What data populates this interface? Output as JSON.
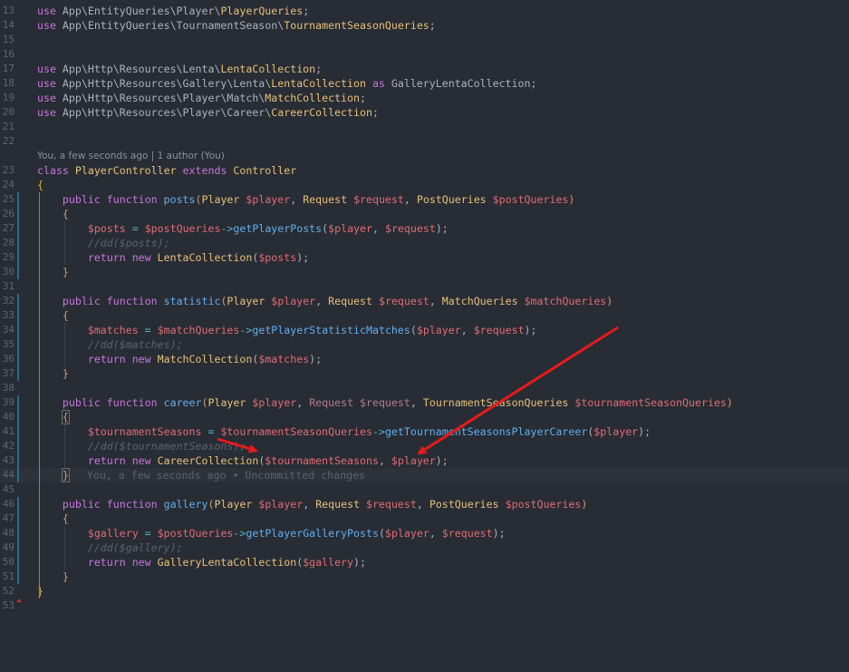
{
  "editor": {
    "blame_header": "You, a few seconds ago | 1 author (You)",
    "inline_blame": "You, a few seconds ago • Uncommitted changes",
    "lines": [
      {
        "n": "13",
        "tokens": [
          [
            "kw",
            "use "
          ],
          [
            "ns",
            "App\\EntityQueries\\Player\\"
          ],
          [
            "cls",
            "PlayerQueries"
          ],
          [
            "pun",
            ";"
          ]
        ]
      },
      {
        "n": "14",
        "tokens": [
          [
            "kw",
            "use "
          ],
          [
            "ns",
            "App\\EntityQueries\\TournamentSeason\\"
          ],
          [
            "cls",
            "TournamentSeasonQueries"
          ],
          [
            "pun",
            ";"
          ]
        ]
      },
      {
        "n": "15",
        "tokens": []
      },
      {
        "n": "16",
        "tokens": []
      },
      {
        "n": "17",
        "tokens": [
          [
            "kw",
            "use "
          ],
          [
            "ns",
            "App\\Http\\Resources\\Lenta\\"
          ],
          [
            "cls",
            "LentaCollection"
          ],
          [
            "pun",
            ";"
          ]
        ]
      },
      {
        "n": "18",
        "tokens": [
          [
            "kw",
            "use "
          ],
          [
            "ns",
            "App\\Http\\Resources\\Gallery\\Lenta\\"
          ],
          [
            "cls",
            "LentaCollection"
          ],
          [
            "kw",
            " as "
          ],
          [
            "ns",
            "GalleryLentaCollection"
          ],
          [
            "pun",
            ";"
          ]
        ]
      },
      {
        "n": "19",
        "tokens": [
          [
            "kw",
            "use "
          ],
          [
            "ns",
            "App\\Http\\Resources\\Player\\Match\\"
          ],
          [
            "cls",
            "MatchCollection"
          ],
          [
            "pun",
            ";"
          ]
        ]
      },
      {
        "n": "20",
        "tokens": [
          [
            "kw",
            "use "
          ],
          [
            "ns",
            "App\\Http\\Resources\\Player\\Career\\"
          ],
          [
            "cls",
            "CareerCollection"
          ],
          [
            "pun",
            ";"
          ]
        ]
      },
      {
        "n": "21",
        "tokens": []
      },
      {
        "n": "22",
        "tokens": []
      },
      {
        "n": "23",
        "tokens": [
          [
            "kw",
            "class "
          ],
          [
            "cls",
            "PlayerController "
          ],
          [
            "kw",
            "extends "
          ],
          [
            "cls",
            "Controller"
          ]
        ]
      },
      {
        "n": "24",
        "tokens": [
          [
            "brace",
            "{"
          ]
        ]
      },
      {
        "n": "25",
        "tokens": [
          [
            "pun",
            "    "
          ],
          [
            "kw",
            "public function "
          ],
          [
            "fn",
            "posts"
          ],
          [
            "br",
            "("
          ],
          [
            "cls",
            "Player "
          ],
          [
            "var",
            "$player"
          ],
          [
            "pun",
            ", "
          ],
          [
            "cls",
            "Request "
          ],
          [
            "var",
            "$request"
          ],
          [
            "pun",
            ", "
          ],
          [
            "cls",
            "PostQueries "
          ],
          [
            "var",
            "$postQueries"
          ],
          [
            "br",
            ")"
          ]
        ]
      },
      {
        "n": "26",
        "tokens": [
          [
            "pun",
            "    "
          ],
          [
            "br",
            "{"
          ]
        ]
      },
      {
        "n": "27",
        "tokens": [
          [
            "pun",
            "        "
          ],
          [
            "var",
            "$posts"
          ],
          [
            "op",
            " = "
          ],
          [
            "var",
            "$postQueries"
          ],
          [
            "op",
            "->"
          ],
          [
            "fn",
            "getPlayerPosts"
          ],
          [
            "pun",
            "("
          ],
          [
            "var",
            "$player"
          ],
          [
            "pun",
            ", "
          ],
          [
            "var",
            "$request"
          ],
          [
            "pun",
            ");"
          ]
        ]
      },
      {
        "n": "28",
        "tokens": [
          [
            "pun",
            "        "
          ],
          [
            "cmt",
            "//dd($posts);"
          ]
        ]
      },
      {
        "n": "29",
        "tokens": [
          [
            "pun",
            "        "
          ],
          [
            "kw",
            "return new "
          ],
          [
            "cls",
            "LentaCollection"
          ],
          [
            "pun",
            "("
          ],
          [
            "var",
            "$posts"
          ],
          [
            "pun",
            ");"
          ]
        ]
      },
      {
        "n": "30",
        "tokens": [
          [
            "pun",
            "    "
          ],
          [
            "br",
            "}"
          ]
        ]
      },
      {
        "n": "31",
        "tokens": []
      },
      {
        "n": "32",
        "tokens": [
          [
            "pun",
            "    "
          ],
          [
            "kw",
            "public function "
          ],
          [
            "fn",
            "statistic"
          ],
          [
            "br",
            "("
          ],
          [
            "cls",
            "Player "
          ],
          [
            "var",
            "$player"
          ],
          [
            "pun",
            ", "
          ],
          [
            "cls",
            "Request "
          ],
          [
            "var",
            "$request"
          ],
          [
            "pun",
            ", "
          ],
          [
            "cls",
            "MatchQueries "
          ],
          [
            "var",
            "$matchQueries"
          ],
          [
            "br",
            ")"
          ]
        ]
      },
      {
        "n": "33",
        "tokens": [
          [
            "pun",
            "    "
          ],
          [
            "br",
            "{"
          ]
        ]
      },
      {
        "n": "34",
        "tokens": [
          [
            "pun",
            "        "
          ],
          [
            "var",
            "$matches"
          ],
          [
            "op",
            " = "
          ],
          [
            "var",
            "$matchQueries"
          ],
          [
            "op",
            "->"
          ],
          [
            "fn",
            "getPlayerStatisticMatches"
          ],
          [
            "pun",
            "("
          ],
          [
            "var",
            "$player"
          ],
          [
            "pun",
            ", "
          ],
          [
            "var",
            "$request"
          ],
          [
            "pun",
            ");"
          ]
        ]
      },
      {
        "n": "35",
        "tokens": [
          [
            "pun",
            "        "
          ],
          [
            "cmt",
            "//dd($matches);"
          ]
        ]
      },
      {
        "n": "36",
        "tokens": [
          [
            "pun",
            "        "
          ],
          [
            "kw",
            "return new "
          ],
          [
            "cls",
            "MatchCollection"
          ],
          [
            "pun",
            "("
          ],
          [
            "var",
            "$matches"
          ],
          [
            "pun",
            ");"
          ]
        ]
      },
      {
        "n": "37",
        "tokens": [
          [
            "pun",
            "    "
          ],
          [
            "br",
            "}"
          ]
        ]
      },
      {
        "n": "38",
        "tokens": []
      },
      {
        "n": "39",
        "tokens": [
          [
            "pun",
            "    "
          ],
          [
            "kw",
            "public function "
          ],
          [
            "fn",
            "career"
          ],
          [
            "br",
            "("
          ],
          [
            "cls",
            "Player "
          ],
          [
            "var",
            "$player"
          ],
          [
            "pun",
            ", "
          ],
          [
            "dim",
            "Request $request"
          ],
          [
            "pun",
            ", "
          ],
          [
            "cls",
            "TournamentSeasonQueries "
          ],
          [
            "var",
            "$tournamentSeasonQueries"
          ],
          [
            "br",
            ")"
          ]
        ]
      },
      {
        "n": "40",
        "tokens": [
          [
            "pun",
            "    "
          ],
          [
            "br",
            "{"
          ]
        ]
      },
      {
        "n": "41",
        "tokens": [
          [
            "pun",
            "        "
          ],
          [
            "var",
            "$tournamentSeasons"
          ],
          [
            "op",
            " = "
          ],
          [
            "var",
            "$tournamentSeasonQueries"
          ],
          [
            "op",
            "->"
          ],
          [
            "fn",
            "getTournamentSeasonsPlayerCareer"
          ],
          [
            "pun",
            "("
          ],
          [
            "var",
            "$player"
          ],
          [
            "pun",
            ");"
          ]
        ]
      },
      {
        "n": "42",
        "tokens": [
          [
            "pun",
            "        "
          ],
          [
            "cmt",
            "//dd($tournamentSeasons);"
          ]
        ]
      },
      {
        "n": "43",
        "tokens": [
          [
            "pun",
            "        "
          ],
          [
            "kw",
            "return new "
          ],
          [
            "cls",
            "CareerCollection"
          ],
          [
            "pun",
            "("
          ],
          [
            "var",
            "$tournamentSeasons"
          ],
          [
            "pun",
            ", "
          ],
          [
            "var",
            "$player"
          ],
          [
            "pun",
            ");"
          ]
        ]
      },
      {
        "n": "44",
        "tokens": [
          [
            "pun",
            "    "
          ],
          [
            "br",
            "}"
          ]
        ]
      },
      {
        "n": "45",
        "tokens": []
      },
      {
        "n": "46",
        "tokens": [
          [
            "pun",
            "    "
          ],
          [
            "kw",
            "public function "
          ],
          [
            "fn",
            "gallery"
          ],
          [
            "br",
            "("
          ],
          [
            "cls",
            "Player "
          ],
          [
            "var",
            "$player"
          ],
          [
            "pun",
            ", "
          ],
          [
            "cls",
            "Request "
          ],
          [
            "var",
            "$request"
          ],
          [
            "pun",
            ", "
          ],
          [
            "cls",
            "PostQueries "
          ],
          [
            "var",
            "$postQueries"
          ],
          [
            "br",
            ")"
          ]
        ]
      },
      {
        "n": "47",
        "tokens": [
          [
            "pun",
            "    "
          ],
          [
            "br",
            "{"
          ]
        ]
      },
      {
        "n": "48",
        "tokens": [
          [
            "pun",
            "        "
          ],
          [
            "var",
            "$gallery"
          ],
          [
            "op",
            " = "
          ],
          [
            "var",
            "$postQueries"
          ],
          [
            "op",
            "->"
          ],
          [
            "fn",
            "getPlayerGalleryPosts"
          ],
          [
            "pun",
            "("
          ],
          [
            "var",
            "$player"
          ],
          [
            "pun",
            ", "
          ],
          [
            "var",
            "$request"
          ],
          [
            "pun",
            ");"
          ]
        ]
      },
      {
        "n": "49",
        "tokens": [
          [
            "pun",
            "        "
          ],
          [
            "cmt",
            "//dd($gallery);"
          ]
        ]
      },
      {
        "n": "50",
        "tokens": [
          [
            "pun",
            "        "
          ],
          [
            "kw",
            "return new "
          ],
          [
            "cls",
            "GalleryLentaCollection"
          ],
          [
            "pun",
            "("
          ],
          [
            "var",
            "$gallery"
          ],
          [
            "pun",
            ");"
          ]
        ]
      },
      {
        "n": "51",
        "tokens": [
          [
            "pun",
            "    "
          ],
          [
            "br",
            "}"
          ]
        ]
      },
      {
        "n": "52",
        "tokens": [
          [
            "brace",
            "}"
          ]
        ]
      },
      {
        "n": "53",
        "tokens": []
      }
    ]
  },
  "colors": {
    "background": "#282c34",
    "keyword": "#c678dd",
    "class": "#e5c07b",
    "function": "#61afef",
    "variable": "#e06c75",
    "comment": "#5c6370",
    "annotation_arrow": "#e41b1b"
  }
}
